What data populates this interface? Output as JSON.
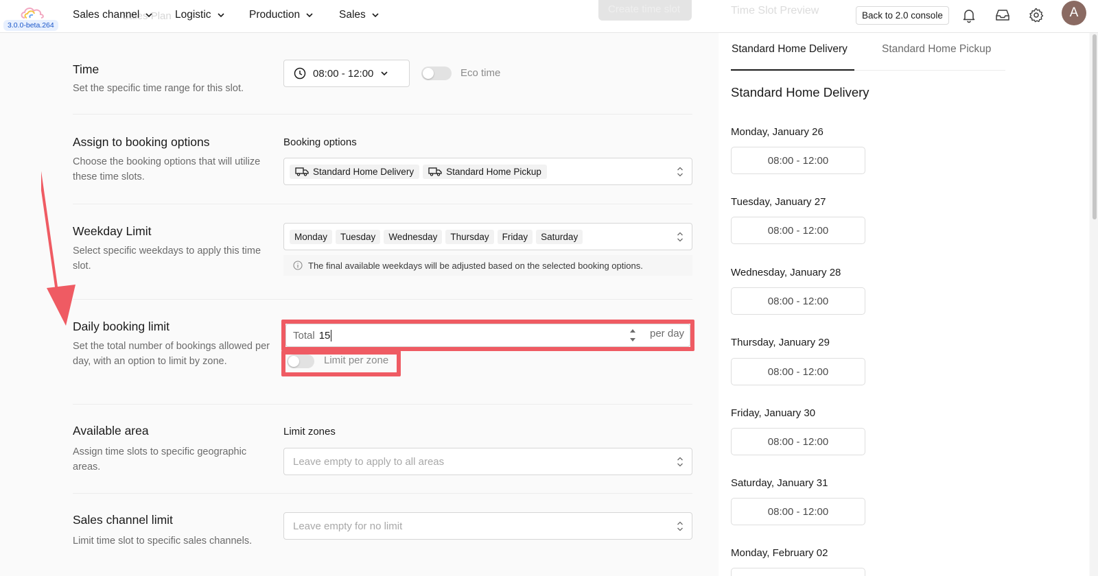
{
  "app": {
    "version": "3.0.0-beta.264",
    "background_ghost_text": "Sales Plan",
    "accent_color": "#ef5b63"
  },
  "nav": {
    "items": [
      {
        "label": "Sales channel",
        "icon": "chevron-down-icon"
      },
      {
        "label": "Logistic",
        "icon": "chevron-down-icon"
      },
      {
        "label": "Production",
        "icon": "chevron-down-icon"
      },
      {
        "label": "Sales",
        "icon": "chevron-down-icon"
      }
    ],
    "ghost_button": "Create time slot",
    "back_button": "Back to 2.0 console",
    "icons": [
      "bell-icon",
      "inbox-icon",
      "gear-icon"
    ],
    "avatar_initial": "A"
  },
  "form": {
    "time": {
      "title": "Time",
      "description": "Set the specific time range for this slot.",
      "value": "08:00 - 12:00",
      "eco_label": "Eco time",
      "eco_enabled": false
    },
    "booking": {
      "title": "Assign to booking options",
      "description": "Choose the booking options that will utilize these time slots.",
      "field_label": "Booking options",
      "tags": [
        "Standard Home Delivery",
        "Standard Home Pickup"
      ]
    },
    "weekday": {
      "title": "Weekday Limit",
      "description": "Select specific weekdays to apply this time slot.",
      "tags": [
        "Monday",
        "Tuesday",
        "Wednesday",
        "Thursday",
        "Friday",
        "Saturday"
      ],
      "hint": "The final available weekdays will be adjusted based on the selected booking options."
    },
    "daily": {
      "title": "Daily booking limit",
      "description": "Set the total number of bookings allowed per day, with an option to limit by zone.",
      "prefix": "Total",
      "value": "15",
      "suffix": "per day",
      "zone_toggle_label": "Limit per zone",
      "zone_enabled": false
    },
    "area": {
      "title": "Available area",
      "description": "Assign time slots to specific geographic areas.",
      "field_label": "Limit zones",
      "placeholder": "Leave empty to apply to all areas"
    },
    "sales_channel": {
      "title": "Sales channel limit",
      "description": "Limit time slot to specific sales channels.",
      "placeholder": "Leave empty for no limit"
    }
  },
  "preview": {
    "ghost_title": "Time Slot Preview",
    "tabs": [
      "Standard Home Delivery",
      "Standard Home Pickup"
    ],
    "active_tab": "Standard Home Delivery",
    "title": "Standard Home Delivery",
    "days": [
      {
        "date": "Monday, January 26",
        "slot": "08:00 - 12:00"
      },
      {
        "date": "Tuesday, January 27",
        "slot": "08:00 - 12:00"
      },
      {
        "date": "Wednesday, January 28",
        "slot": "08:00 - 12:00"
      },
      {
        "date": "Thursday, January 29",
        "slot": "08:00 - 12:00"
      },
      {
        "date": "Friday, January 30",
        "slot": "08:00 - 12:00"
      },
      {
        "date": "Saturday, January 31",
        "slot": "08:00 - 12:00"
      },
      {
        "date": "Monday, February 02",
        "slot": ""
      }
    ]
  }
}
